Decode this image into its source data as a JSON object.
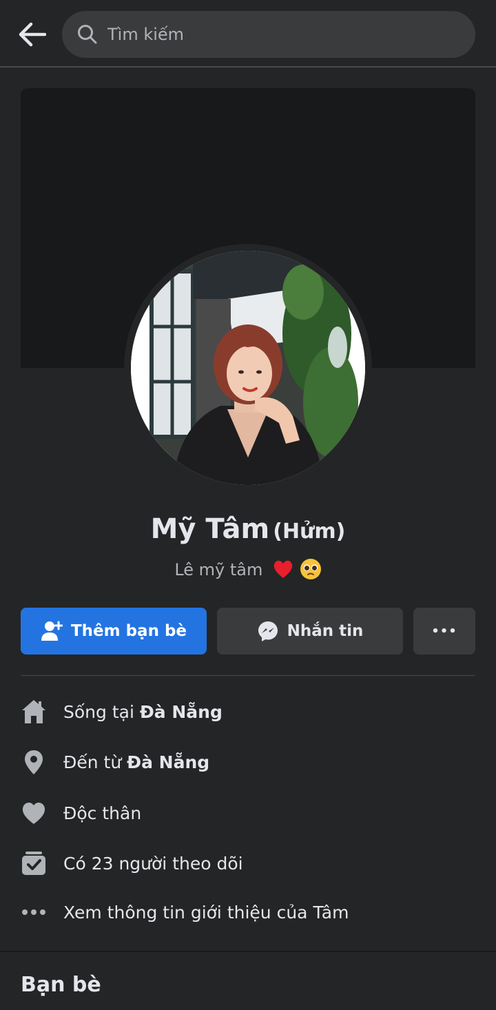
{
  "search": {
    "placeholder": "Tìm kiếm"
  },
  "profile": {
    "name": "Mỹ Tâm",
    "nickname": "(Hửm)",
    "bio": "Lê mỹ tâm",
    "bio_emojis": [
      "red-heart",
      "pleading-face"
    ]
  },
  "actions": {
    "add_friend": "Thêm bạn bè",
    "message": "Nhắn tin",
    "more": "•••"
  },
  "intro": {
    "lives_prefix": "Sống tại ",
    "lives_city": "Đà Nẵng",
    "from_prefix": "Đến từ ",
    "from_city": "Đà Nẵng",
    "relationship": "Độc thân",
    "followers": "Có 23 người theo dõi",
    "see_about": "Xem thông tin giới thiệu của Tâm"
  },
  "sections": {
    "friends_title": "Bạn bè"
  },
  "colors": {
    "accent": "#2374e1",
    "background": "#242526",
    "card": "#3a3b3c"
  }
}
